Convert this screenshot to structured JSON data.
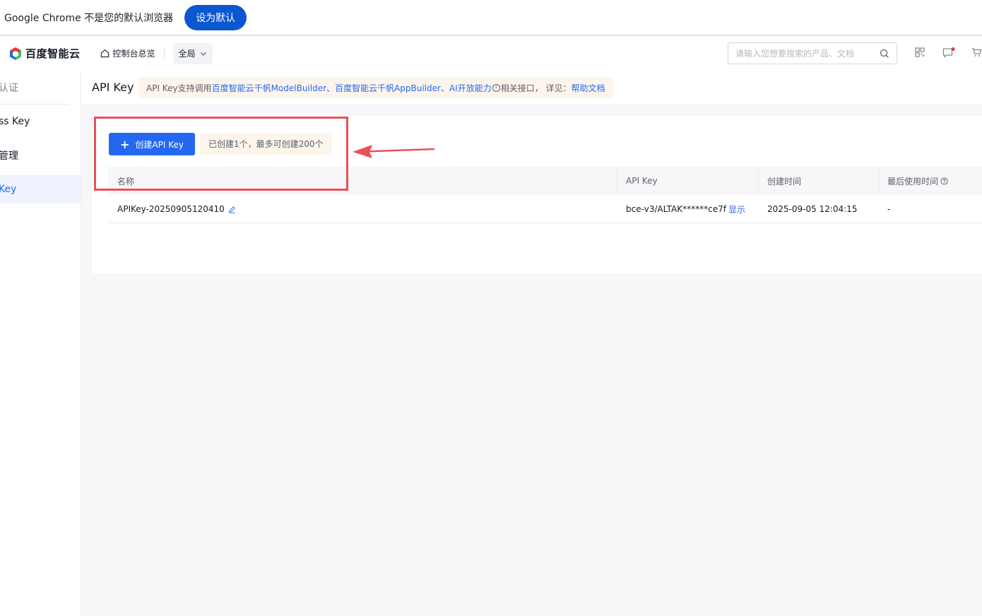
{
  "infobar": {
    "message": "Google Chrome 不是您的默认浏览器",
    "set_default_label": "设为默认"
  },
  "topnav": {
    "logo_text": "百度智能云",
    "home_label": "控制台总览",
    "scope_label": "全局",
    "search_placeholder": "请输入您想要搜索的产品、文档",
    "icons": [
      "qrcode-icon",
      "message-icon",
      "cart-icon"
    ]
  },
  "sidebar": {
    "items": [
      {
        "label": "认证"
      },
      {
        "label": "ss Key"
      },
      {
        "label": "管理"
      },
      {
        "label": "Key"
      }
    ]
  },
  "header": {
    "title": "API Key",
    "notice_prefix": "API Key支持调用",
    "notice_link1": "百度智能云千帆ModelBuilder",
    "notice_sep1": "、",
    "notice_link2": "百度智能云千帆AppBuilder",
    "notice_sep2": "、",
    "notice_link3": "AI开放能力",
    "notice_info": "!",
    "notice_mid": "相关接口， 详见：",
    "notice_link4": "帮助文档"
  },
  "main": {
    "create_button_label": "创建API Key",
    "create_button_icon": "+",
    "count_tag": "已创建1个，最多可创建200个",
    "columns": [
      "名称",
      "API Key",
      "创建时间",
      "最后使用时间"
    ],
    "rows": [
      {
        "name": "APIKey-20250905120410",
        "api_key": "bce-v3/ALTAK******ce7f",
        "show_label": "显示",
        "created": "2025-09-05 12:04:15",
        "last_used": "-"
      }
    ]
  },
  "colors": {
    "primary": "#2468f2",
    "annotation_red": "#e9505a",
    "chrome_blue": "#0b57d0"
  }
}
